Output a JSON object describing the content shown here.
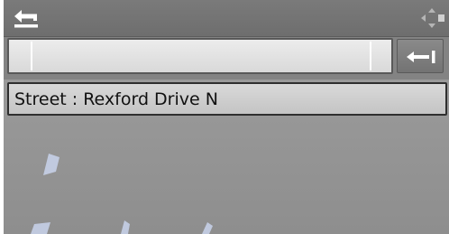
{
  "header": {
    "back_icon": "back-arrow-icon",
    "nav_hint_icon": "four-way-nav-icon"
  },
  "input": {
    "value": "",
    "placeholder": ""
  },
  "enter_button": {
    "icon": "enter-return-icon"
  },
  "results": {
    "items": [
      {
        "label": "Street : Rexford Drive N",
        "selected": true
      }
    ]
  },
  "colors": {
    "frame_bg": "#838383",
    "field_bg": "#e3e3e3",
    "selected_item_bg": "#cdcdcd",
    "map_shape": "#c9d3ec"
  }
}
